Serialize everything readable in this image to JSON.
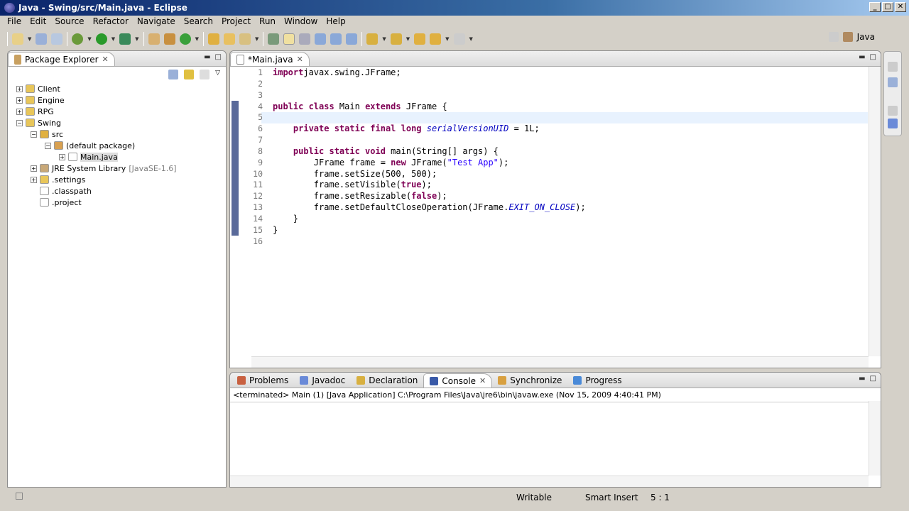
{
  "window": {
    "title": "Java - Swing/src/Main.java - Eclipse",
    "min": "_",
    "max": "□",
    "close": "✕"
  },
  "menu": [
    "File",
    "Edit",
    "Source",
    "Refactor",
    "Navigate",
    "Search",
    "Project",
    "Run",
    "Window",
    "Help"
  ],
  "perspective": {
    "label": "Java"
  },
  "package_explorer": {
    "title": "Package Explorer",
    "tree": [
      {
        "label": "Client",
        "level": 0,
        "exp": "+",
        "icon": "project-folder"
      },
      {
        "label": "Engine",
        "level": 0,
        "exp": "+",
        "icon": "project-folder"
      },
      {
        "label": "RPG",
        "level": 0,
        "exp": "+",
        "icon": "project-folder"
      },
      {
        "label": "Swing",
        "level": 0,
        "exp": "-",
        "icon": "project-folder"
      },
      {
        "label": "src",
        "level": 1,
        "exp": "-",
        "icon": "source-folder"
      },
      {
        "label": "(default package)",
        "level": 2,
        "exp": "-",
        "icon": "package"
      },
      {
        "label": "Main.java",
        "level": 3,
        "exp": "+",
        "icon": "java-file",
        "selected": true
      },
      {
        "label": "JRE System Library",
        "extra": "[JavaSE-1.6]",
        "level": 1,
        "exp": "+",
        "icon": "library"
      },
      {
        "label": ".settings",
        "level": 1,
        "exp": "+",
        "icon": "folder"
      },
      {
        "label": ".classpath",
        "level": 1,
        "exp": "",
        "icon": "xml-file"
      },
      {
        "label": ".project",
        "level": 1,
        "exp": "",
        "icon": "xml-file"
      }
    ]
  },
  "editor": {
    "tab": "*Main.java",
    "lines": [
      [
        [
          "kw",
          "import"
        ],
        [
          "",
          "javax.swing.JFrame;"
        ]
      ],
      [],
      [],
      [
        [
          "kw",
          "public class"
        ],
        [
          "",
          " Main "
        ],
        [
          "kw",
          "extends"
        ],
        [
          "",
          " JFrame {"
        ]
      ],
      [],
      [
        [
          "",
          "    "
        ],
        [
          "kw",
          "private static final long"
        ],
        [
          "",
          " "
        ],
        [
          "fld",
          "serialVersionUID"
        ],
        [
          "",
          " = 1L;"
        ]
      ],
      [],
      [
        [
          "",
          "    "
        ],
        [
          "kw",
          "public static void"
        ],
        [
          "",
          " main(String[] args) {"
        ]
      ],
      [
        [
          "",
          "        JFrame frame = "
        ],
        [
          "kw",
          "new"
        ],
        [
          "",
          " JFrame("
        ],
        [
          "str",
          "\"Test App\""
        ],
        [
          "",
          ");"
        ]
      ],
      [
        [
          "",
          "        frame.setSize(500, 500);"
        ]
      ],
      [
        [
          "",
          "        frame.setVisible("
        ],
        [
          "kw",
          "true"
        ],
        [
          "",
          ");"
        ]
      ],
      [
        [
          "",
          "        frame.setResizable("
        ],
        [
          "kw",
          "false"
        ],
        [
          "",
          ");"
        ]
      ],
      [
        [
          "",
          "        frame.setDefaultCloseOperation(JFrame."
        ],
        [
          "fld",
          "EXIT_ON_CLOSE"
        ],
        [
          "",
          ");"
        ]
      ],
      [
        [
          "",
          "    }"
        ]
      ],
      [
        [
          "",
          "}"
        ]
      ],
      []
    ]
  },
  "console": {
    "tabs": [
      "Problems",
      "Javadoc",
      "Declaration",
      "Console",
      "Synchronize",
      "Progress"
    ],
    "active": "Console",
    "header": "<terminated> Main (1) [Java Application] C:\\Program Files\\Java\\jre6\\bin\\javaw.exe (Nov 15, 2009 4:40:41 PM)"
  },
  "status": {
    "writable": "Writable",
    "insert_mode": "Smart Insert",
    "position": "5 : 1"
  }
}
